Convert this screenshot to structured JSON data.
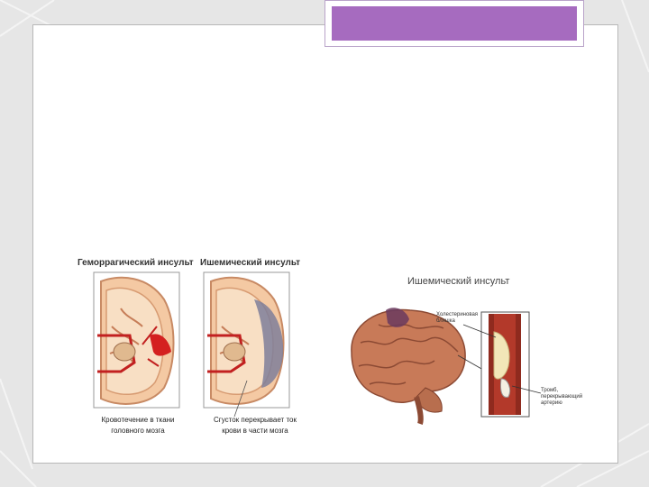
{
  "slide": {
    "title_bar_color": "#a66bbf",
    "accent_border": "#b9a3c9"
  },
  "figure_left": {
    "label_hemorrhagic": "Геморрагический инсульт",
    "label_ischemic": "Ишемический инсульт",
    "note_hemorrhagic_line1": "Кровотечение в ткани",
    "note_hemorrhagic_line2": "головного мозга",
    "note_ischemic_line1": "Сгусток перекрывает ток",
    "note_ischemic_line2": "крови в части мозга"
  },
  "figure_right": {
    "title": "Ишемический инсульт",
    "label_plaque_line1": "Холестериновая",
    "label_plaque_line2": "бляшка",
    "label_thrombus_line1": "Тромб,",
    "label_thrombus_line2": "перекрывающий",
    "label_thrombus_line3": "артерию"
  }
}
